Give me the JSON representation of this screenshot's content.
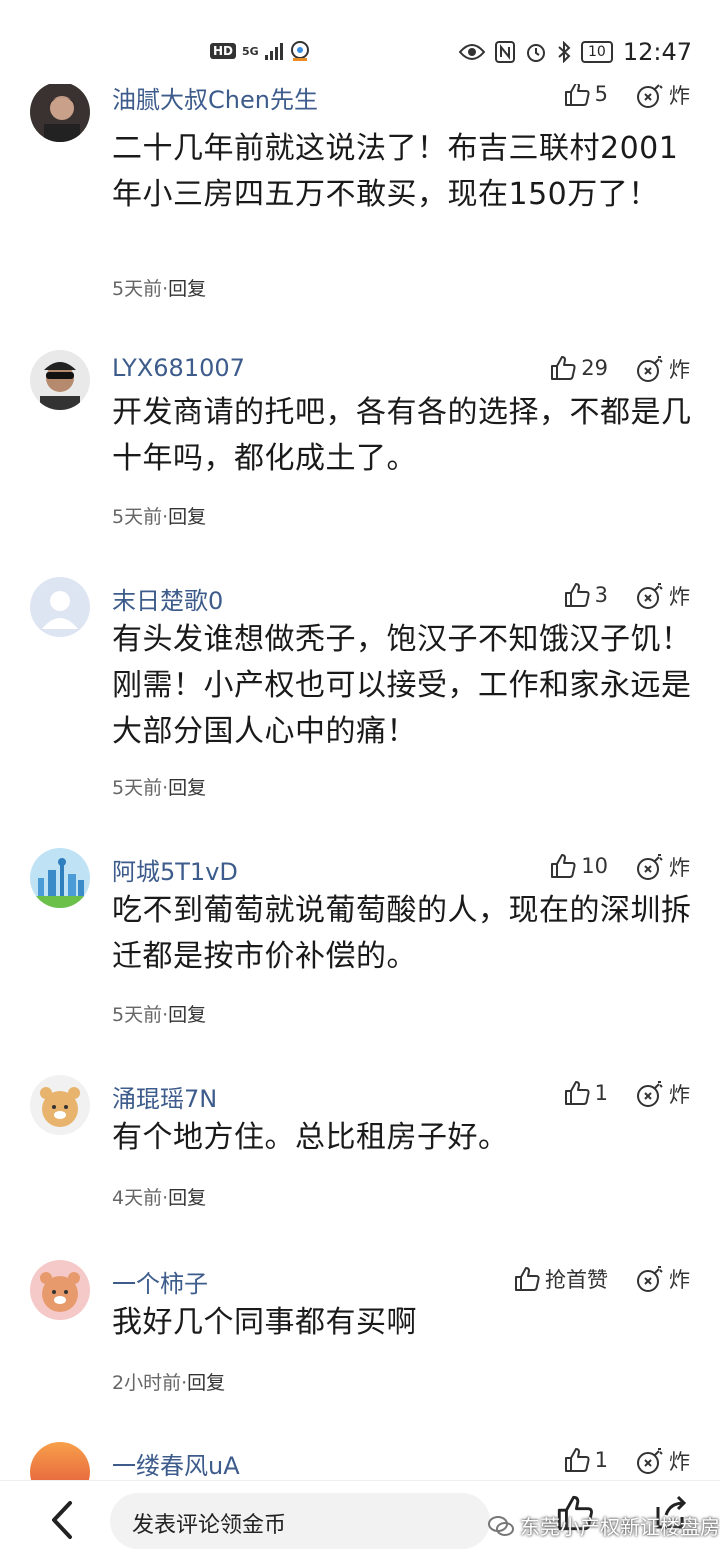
{
  "status_bar": {
    "network": "HD",
    "gen": "5G",
    "battery": "10",
    "time": "12:47"
  },
  "comments": [
    {
      "user": "油腻大叔Chen先生",
      "likes": "5",
      "blast": "炸",
      "text": "二十几年前就这说法了！布吉三联村2001年小三房四五万不敢买，现在150万了！",
      "time": "5天前",
      "reply": "回复"
    },
    {
      "user": "LYX681007",
      "likes": "29",
      "blast": "炸",
      "text": "开发商请的托吧，各有各的选择，不都是几十年吗，都化成土了。",
      "time": "5天前",
      "reply": "回复"
    },
    {
      "user": "末日楚歌0",
      "likes": "3",
      "blast": "炸",
      "text": "有头发谁想做秃子，饱汉子不知饿汉子饥！刚需！小产权也可以接受，工作和家永远是大部分国人心中的痛！",
      "time": "5天前",
      "reply": "回复"
    },
    {
      "user": "阿城5T1vD",
      "likes": "10",
      "blast": "炸",
      "text": "吃不到葡萄就说葡萄酸的人，现在的深圳拆迁都是按市价补偿的。",
      "time": "5天前",
      "reply": "回复"
    },
    {
      "user": "涌琨瑶7N",
      "likes": "1",
      "blast": "炸",
      "text": "有个地方住。总比租房子好。",
      "time": "4天前",
      "reply": "回复"
    },
    {
      "user": "一个柿子",
      "likes": "抢首赞",
      "blast": "炸",
      "text": "我好几个同事都有买啊",
      "time": "2小时前",
      "reply": "回复"
    },
    {
      "user": "一缕春风uA",
      "likes": "1",
      "blast": "炸",
      "text": "",
      "time": "",
      "reply": ""
    }
  ],
  "bottom_bar": {
    "input_placeholder": "发表评论领金币",
    "watermark": "东莞小产权新证楼盘房"
  },
  "colors": {
    "username": "#3d5c8c",
    "text": "#1a1a1a",
    "meta": "#666666",
    "input_bg": "#f2f2f2"
  }
}
